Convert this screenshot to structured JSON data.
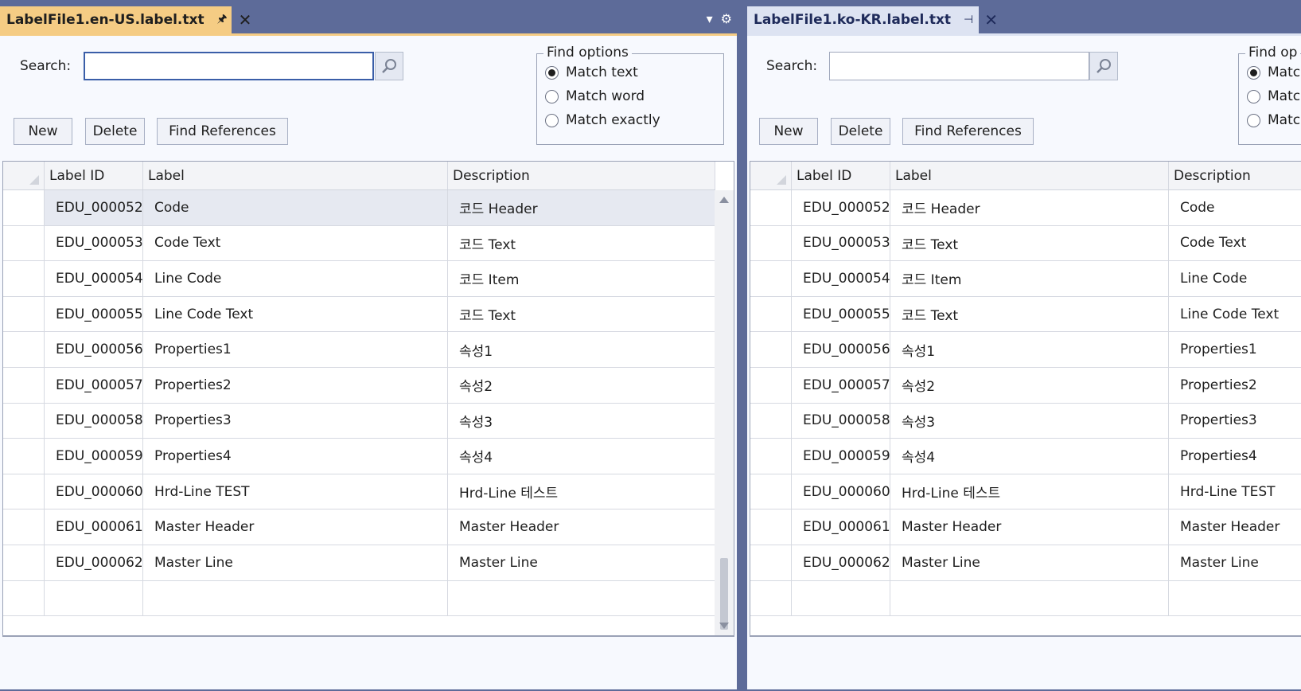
{
  "left": {
    "tab": {
      "title": "LabelFile1.en-US.label.txt",
      "pin_glyph": "🖈",
      "close_glyph": "✕"
    },
    "search_label": "Search:",
    "search_value": "",
    "buttons": {
      "new": "New",
      "delete": "Delete",
      "find_references": "Find References"
    },
    "find_options": {
      "title": "Find options",
      "items": [
        "Match text",
        "Match word",
        "Match exactly"
      ],
      "selected": 0
    },
    "grid": {
      "columns": [
        "Label ID",
        "Label",
        "Description"
      ],
      "rows": [
        [
          "EDU_000052",
          "Code",
          "코드 Header"
        ],
        [
          "EDU_000053",
          "Code Text",
          "코드 Text"
        ],
        [
          "EDU_000054",
          "Line Code",
          "코드 Item"
        ],
        [
          "EDU_000055",
          "Line Code Text",
          "코드 Text"
        ],
        [
          "EDU_000056",
          "Properties1",
          "속성1"
        ],
        [
          "EDU_000057",
          "Properties2",
          "속성2"
        ],
        [
          "EDU_000058",
          "Properties3",
          "속성3"
        ],
        [
          "EDU_000059",
          "Properties4",
          "속성4"
        ],
        [
          "EDU_000060",
          "Hrd-Line TEST",
          "Hrd-Line 테스트"
        ],
        [
          "EDU_000061",
          "Master Header",
          "Master Header"
        ],
        [
          "EDU_000062",
          "Master Line",
          "Master Line"
        ],
        [
          "",
          "",
          ""
        ]
      ]
    }
  },
  "right": {
    "tab": {
      "title": "LabelFile1.ko-KR.label.txt",
      "pin_glyph": "⊣",
      "close_glyph": "✕"
    },
    "search_label": "Search:",
    "search_value": "",
    "buttons": {
      "new": "New",
      "delete": "Delete",
      "find_references": "Find References"
    },
    "find_options": {
      "title": "Find op",
      "items": [
        "Matc",
        "Matc",
        "Matc"
      ],
      "selected": 0
    },
    "grid": {
      "columns": [
        "Label ID",
        "Label",
        "Description"
      ],
      "rows": [
        [
          "EDU_000052",
          "코드 Header",
          "Code"
        ],
        [
          "EDU_000053",
          "코드 Text",
          "Code Text"
        ],
        [
          "EDU_000054",
          "코드 Item",
          "Line Code"
        ],
        [
          "EDU_000055",
          "코드 Text",
          "Line Code Text"
        ],
        [
          "EDU_000056",
          "속성1",
          "Properties1"
        ],
        [
          "EDU_000057",
          "속성2",
          "Properties2"
        ],
        [
          "EDU_000058",
          "속성3",
          "Properties3"
        ],
        [
          "EDU_000059",
          "속성4",
          "Properties4"
        ],
        [
          "EDU_000060",
          "Hrd-Line 테스트",
          "Hrd-Line TEST"
        ],
        [
          "EDU_000061",
          "Master Header",
          "Master Header"
        ],
        [
          "EDU_000062",
          "Master Line",
          "Master Line"
        ],
        [
          "",
          "",
          ""
        ]
      ]
    }
  },
  "strip_tools": {
    "dropdown_glyph": "▾",
    "settings_glyph": "⚙"
  },
  "colors": {
    "active_tab": "#f5cc84",
    "inactive_tab": "#dde3f2",
    "chrome": "#5d6b99"
  }
}
